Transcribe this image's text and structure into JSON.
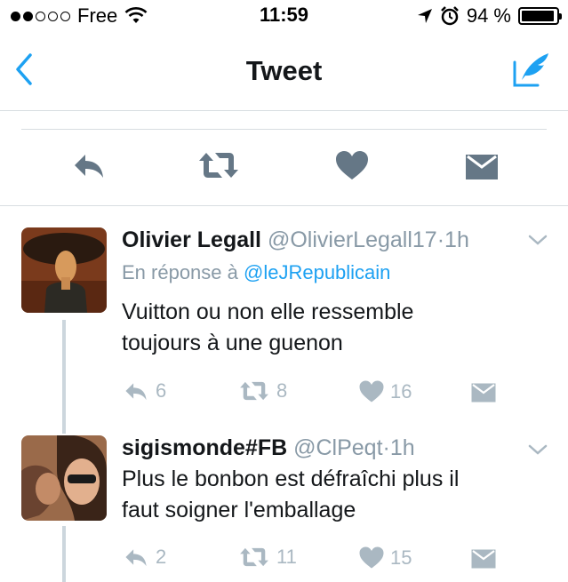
{
  "statusbar": {
    "carrier": "Free",
    "time": "11:59",
    "battery": "94 %",
    "battery_level": 0.94
  },
  "nav": {
    "title": "Tweet"
  },
  "colors": {
    "accent": "#1da1f2",
    "icon_gray": "#657786",
    "light_gray": "#aab8c2",
    "text": "#14171a",
    "secondary": "#8899a6",
    "thread_line": "#ccd6dd"
  },
  "action_bar": {
    "icons": [
      "reply-icon",
      "retweet-icon",
      "like-icon",
      "direct-message-icon"
    ]
  },
  "tweets": [
    {
      "name": "Olivier Legall",
      "handle": "@OlivierLegall17",
      "sep": "·",
      "time": "1h",
      "reply_prefix": "En réponse à",
      "reply_mention": "@leJRepublicain",
      "text_line1": "Vuitton ou non elle ressemble",
      "text_line2": "toujours à une guenon",
      "replies": "6",
      "retweets": "8",
      "likes": "16"
    },
    {
      "name": "sigismonde#FB",
      "handle": "@ClPeqt",
      "sep": "·",
      "time": "1h",
      "text_line1": "Plus le bonbon est défraîchi plus il",
      "text_line2": "faut soigner l'emballage",
      "replies": "2",
      "retweets": "11",
      "likes": "15"
    }
  ]
}
